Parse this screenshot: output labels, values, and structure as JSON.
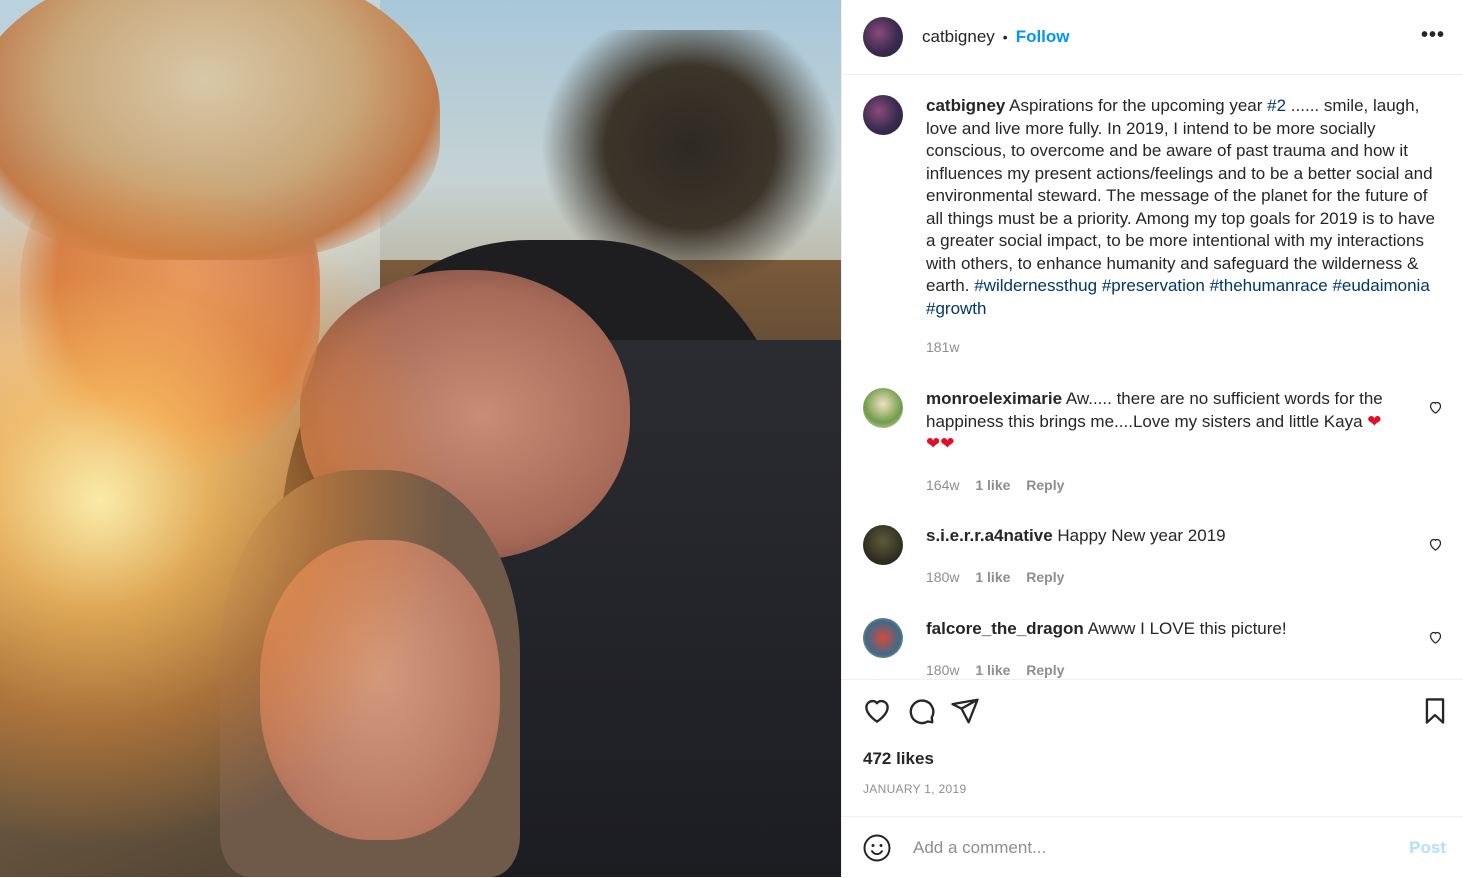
{
  "header": {
    "username": "catbigney",
    "separator": "•",
    "follow_label": "Follow",
    "more_label": "•••"
  },
  "caption": {
    "username": "catbigney",
    "text": "Aspirations for the upcoming year",
    "tag1": "#2",
    "text2": "...... smile, laugh, love and live more fully. In 2019, I intend to be more socially conscious, to overcome and be aware of past trauma and how it influences my present actions/feelings and to be a better social and environmental steward. The message of the planet for the future of all things must be a priority. Among my top goals for 2019 is to have a greater social impact, to be more intentional with my interactions with others, to enhance humanity and safeguard the wilderness & earth.",
    "tags": [
      "#wildernessthug",
      "#preservation",
      "#thehumanrace",
      "#eudaimonia",
      "#growth"
    ],
    "age": "181w"
  },
  "comments": [
    {
      "username": "monroeleximarie",
      "text": "Aw..... there are no sufficient words for the happiness this brings me....Love my sisters and little Kaya",
      "emoji_inline": "❤",
      "emoji_line": "❤❤",
      "age": "164w",
      "likes": "1 like",
      "reply": "Reply"
    },
    {
      "username": "s.i.e.r.r.a4native",
      "text": "Happy New year 2019",
      "age": "180w",
      "likes": "1 like",
      "reply": "Reply"
    },
    {
      "username": "falcore_the_dragon",
      "text": "Awww I LOVE this picture!",
      "age": "180w",
      "likes": "1 like",
      "reply": "Reply"
    }
  ],
  "footer": {
    "likes": "472 likes",
    "date": "JANUARY 1, 2019",
    "comment_placeholder": "Add a comment...",
    "post_label": "Post"
  },
  "colors": {
    "link_blue": "#0095f6",
    "hashtag": "#00376b",
    "muted": "#8e8e8e",
    "post_disabled": "#b2dffc"
  }
}
